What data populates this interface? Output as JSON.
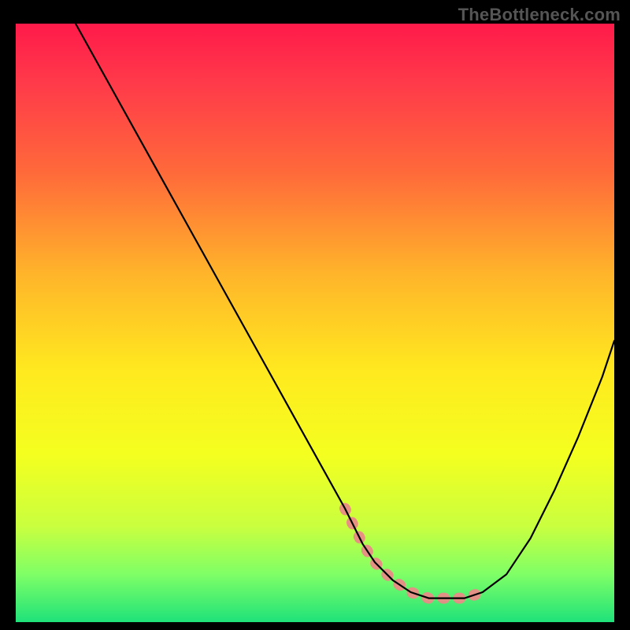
{
  "watermark": "TheBottleneck.com",
  "chart_data": {
    "type": "line",
    "title": "",
    "xlabel": "",
    "ylabel": "",
    "xlim": [
      0,
      100
    ],
    "ylim": [
      0,
      100
    ],
    "series": [
      {
        "name": "curve",
        "x": [
          10,
          15,
          20,
          25,
          30,
          35,
          40,
          45,
          50,
          55,
          58,
          60,
          63,
          66,
          69,
          72,
          75,
          78,
          82,
          86,
          90,
          94,
          98,
          100
        ],
        "y": [
          100,
          91,
          82,
          73,
          64,
          55,
          46,
          37,
          28,
          19,
          13,
          10,
          7,
          5,
          4,
          4,
          4,
          5,
          8,
          14,
          22,
          31,
          41,
          47
        ]
      }
    ],
    "highlight": {
      "x": [
        55,
        58,
        60,
        63,
        66,
        69,
        72,
        75,
        78
      ],
      "y": [
        19,
        13,
        10,
        7,
        5,
        4,
        4,
        4,
        5
      ],
      "color": "#e98b86",
      "stroke_width": 14
    },
    "background_gradient": {
      "stops": [
        {
          "offset": 0.0,
          "color": "#ff1a4a"
        },
        {
          "offset": 0.1,
          "color": "#ff3a4a"
        },
        {
          "offset": 0.25,
          "color": "#ff6a3a"
        },
        {
          "offset": 0.42,
          "color": "#ffb52a"
        },
        {
          "offset": 0.58,
          "color": "#ffe91f"
        },
        {
          "offset": 0.72,
          "color": "#f4ff1f"
        },
        {
          "offset": 0.84,
          "color": "#c9ff3f"
        },
        {
          "offset": 0.92,
          "color": "#7fff66"
        },
        {
          "offset": 1.0,
          "color": "#1fe27a"
        }
      ]
    }
  }
}
